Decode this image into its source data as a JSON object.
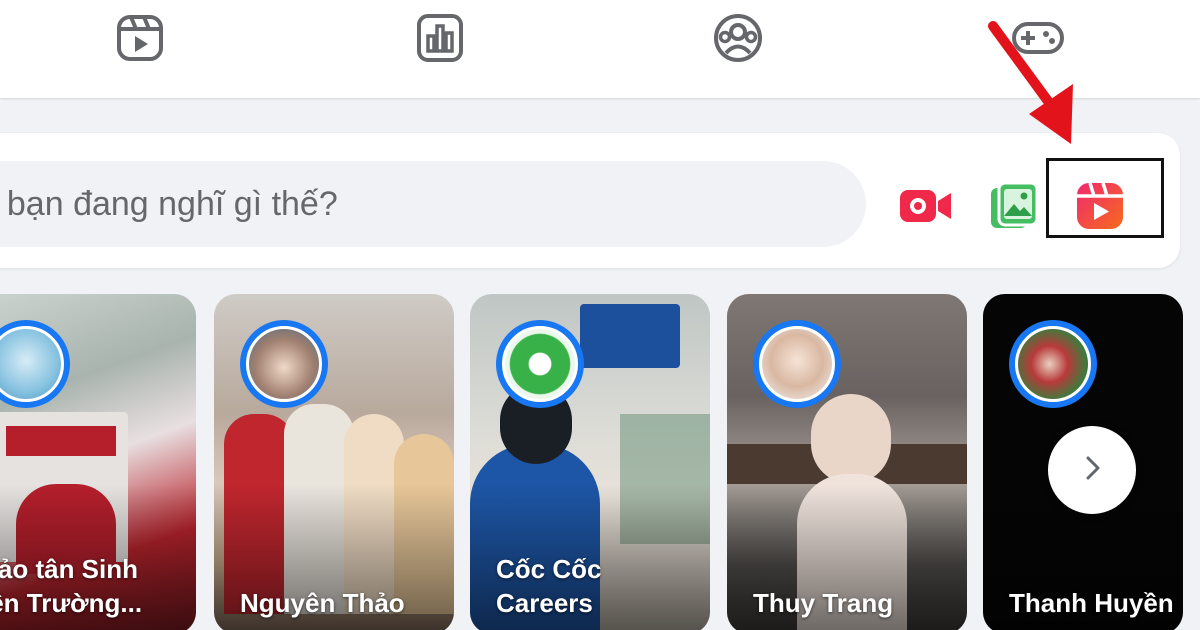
{
  "composer": {
    "placeholder": ", bạn đang nghĩ gì thế?"
  },
  "nav": {
    "icons": [
      "reels-icon",
      "stats-icon",
      "groups-icon",
      "gaming-icon"
    ]
  },
  "actions": {
    "live_icon": "live-video-icon",
    "photo_icon": "photo-video-icon",
    "reel_icon": "reel-icon",
    "colors": {
      "live": "#f02849",
      "photo": "#45bd62",
      "reel": "#f5533d"
    }
  },
  "annotation": {
    "arrow_color": "#e3131b",
    "box_color": "#111111"
  },
  "stories": [
    {
      "name": "hảo tân Sinh\niên Trường..."
    },
    {
      "name": "Nguyên Thảo"
    },
    {
      "name": "Cốc Cốc\nCareers"
    },
    {
      "name": "Thuy Trang"
    },
    {
      "name": "Thanh Huyền"
    }
  ],
  "stories_nav": {
    "next_icon": "chevron-right-icon"
  }
}
